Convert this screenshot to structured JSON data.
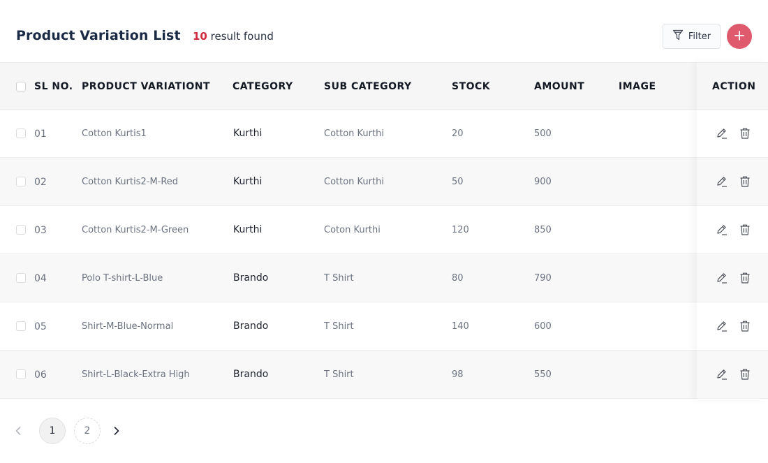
{
  "header": {
    "title": "Product Variation List",
    "result_count": "10",
    "result_text": "result found",
    "filter_label": "Filter"
  },
  "table": {
    "columns": [
      "SL NO.",
      "PRODUCT VARIATIONT",
      "CATEGORY",
      "SUB CATEGORY",
      "STOCK",
      "AMOUNT",
      "IMAGE",
      "ACTION"
    ],
    "rows": [
      {
        "sl": "01",
        "product": "Cotton Kurtis1",
        "category": "Kurthi",
        "subcategory": "Cotton Kurthi",
        "stock": "20",
        "amount": "500"
      },
      {
        "sl": "02",
        "product": "Cotton Kurtis2-M-Red",
        "category": "Kurthi",
        "subcategory": "Cotton Kurthi",
        "stock": "50",
        "amount": "900"
      },
      {
        "sl": "03",
        "product": "Cotton Kurtis2-M-Green",
        "category": "Kurthi",
        "subcategory": "Coton Kurthi",
        "stock": "120",
        "amount": "850"
      },
      {
        "sl": "04",
        "product": "Polo T-shirt-L-Blue",
        "category": "Brando",
        "subcategory": "T Shirt",
        "stock": "80",
        "amount": "790"
      },
      {
        "sl": "05",
        "product": "Shirt-M-Blue-Normal",
        "category": "Brando",
        "subcategory": "T Shirt",
        "stock": "140",
        "amount": "600"
      },
      {
        "sl": "06",
        "product": "Shirt-L-Black-Extra High",
        "category": "Brando",
        "subcategory": "T Shirt",
        "stock": "98",
        "amount": "550"
      }
    ]
  },
  "pagination": {
    "pages": [
      "1",
      "2"
    ],
    "current": "1"
  },
  "icons": {
    "filter": "funnel-icon",
    "add": "plus-icon",
    "edit": "pencil-icon",
    "delete": "trash-icon",
    "prev": "chevron-left-icon",
    "next": "chevron-right-icon"
  },
  "colors": {
    "accent": "#e05a6d",
    "count": "#d0283c",
    "title": "#1b2a44"
  }
}
